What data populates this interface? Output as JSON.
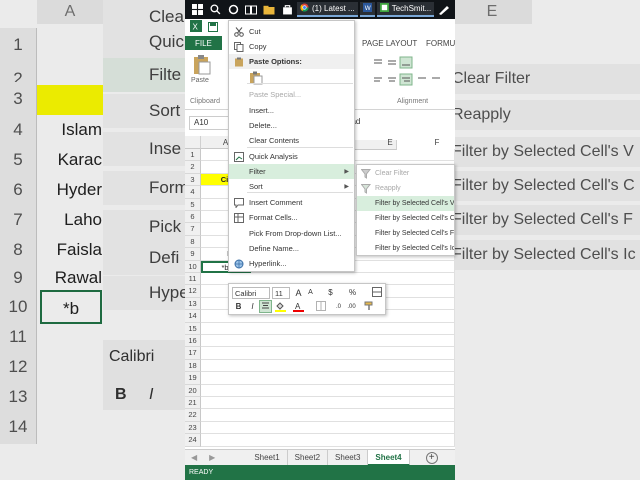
{
  "background": {
    "cities": [
      "Islam",
      "Karac",
      "Hyder",
      "Laho",
      "Faisla",
      "Rawal",
      "*b"
    ],
    "row_numbers": [
      "1",
      "2",
      "3",
      "4",
      "5",
      "6",
      "7",
      "8",
      "9",
      "10",
      "11",
      "12",
      "13",
      "14"
    ],
    "col_headers": [
      "A",
      "E"
    ],
    "menu_items": [
      "Clea",
      "Quic",
      "Filte",
      "Sort",
      "Inse",
      "Form",
      "Pick",
      "Defi",
      "Hype"
    ],
    "submenu_items": [
      "Clear Filter",
      "Reapply",
      "Filter by Selected Cell's V",
      "Filter by Selected Cell's C",
      "Filter by Selected Cell's F",
      "Filter by Selected Cell's Ic"
    ],
    "font_name": "Calibri",
    "bold": "B",
    "italic": "I"
  },
  "taskbar": {
    "apps": [
      {
        "icon": "chrome-icon",
        "label": "(1) Latest ..."
      },
      {
        "icon": "word-icon",
        "label": ""
      },
      {
        "icon": "techsmith-icon",
        "label": "TechSmit..."
      }
    ]
  },
  "ribbon": {
    "tabs": [
      "FILE",
      "PAGE LAYOUT",
      "FORMUL"
    ],
    "paste_label": "Paste",
    "clipboard_label": "Clipboard",
    "alignment_label": "Alignment"
  },
  "formula_bar": {
    "name_box": "A10",
    "content": "oad"
  },
  "grid": {
    "columns": [
      "",
      "A",
      "",
      "",
      "E",
      "F"
    ],
    "rows": [
      "1",
      "2",
      "3",
      "4",
      "5",
      "6",
      "7",
      "8",
      "9",
      "10",
      "11",
      "12",
      "13",
      "14",
      "15",
      "16",
      "17",
      "18",
      "19",
      "20",
      "21",
      "22",
      "23",
      "24"
    ],
    "cells": [
      {
        "row": 3,
        "text": "Ci",
        "style": "header"
      },
      {
        "row": 4,
        "text": "Islam"
      },
      {
        "row": 5,
        "text": "Kara"
      },
      {
        "row": 6,
        "text": "Hyder"
      },
      {
        "row": 7,
        "text": "Lah"
      },
      {
        "row": 8,
        "text": "Faisl"
      },
      {
        "row": 9,
        "text": "Rawal"
      },
      {
        "row": 10,
        "text": "*b",
        "style": "active"
      }
    ],
    "header_color": "#ffff00"
  },
  "context_menu": {
    "items": [
      {
        "label": "Cut",
        "icon": "scissors-icon",
        "state": "normal"
      },
      {
        "label": "Copy",
        "icon": "copy-icon",
        "state": "normal"
      },
      {
        "label": "Paste Options:",
        "icon": "clipboard-icon",
        "state": "section"
      },
      {
        "label": "",
        "icon": "paste-icon",
        "state": "paste-btn"
      },
      {
        "label": "Paste Special...",
        "icon": "",
        "state": "disabled"
      },
      {
        "label": "Insert...",
        "icon": "",
        "state": "normal"
      },
      {
        "label": "Delete...",
        "icon": "",
        "state": "normal"
      },
      {
        "label": "Clear Contents",
        "icon": "",
        "state": "normal"
      },
      {
        "label": "Quick Analysis",
        "icon": "quick-analysis-icon",
        "state": "normal"
      },
      {
        "label": "Filter",
        "icon": "",
        "state": "highlight",
        "submenu": true
      },
      {
        "label": "Sort",
        "icon": "",
        "state": "normal",
        "submenu": true
      },
      {
        "label": "Insert Comment",
        "icon": "comment-icon",
        "state": "normal"
      },
      {
        "label": "Format Cells...",
        "icon": "format-cells-icon",
        "state": "normal"
      },
      {
        "label": "Pick From Drop-down List...",
        "icon": "",
        "state": "normal"
      },
      {
        "label": "Define Name...",
        "icon": "",
        "state": "normal"
      },
      {
        "label": "Hyperlink...",
        "icon": "hyperlink-icon",
        "state": "normal"
      }
    ]
  },
  "filter_submenu": {
    "items": [
      {
        "label": "Clear Filter",
        "icon": "clear-filter-icon",
        "state": "disabled"
      },
      {
        "label": "Reapply",
        "icon": "reapply-icon",
        "state": "disabled"
      },
      {
        "label": "Filter by Selected Cell's V",
        "icon": "",
        "state": "highlight"
      },
      {
        "label": "Filter by Selected Cell's C",
        "icon": "",
        "state": "normal"
      },
      {
        "label": "Filter by Selected Cell's F",
        "icon": "",
        "state": "normal"
      },
      {
        "label": "Filter by Selected Cell's Ic",
        "icon": "",
        "state": "normal"
      }
    ]
  },
  "mini_toolbar": {
    "font": "Calibri",
    "size": "11",
    "grow": "A",
    "shrink": "A",
    "currency": "$",
    "percent": "%",
    "bold": "B",
    "italic": "I"
  },
  "sheets": {
    "tabs": [
      "Sheet1",
      "Sheet2",
      "Sheet3",
      "Sheet4"
    ],
    "active": "Sheet4"
  },
  "status": {
    "text": "READY"
  },
  "colors": {
    "excel_green": "#217346",
    "highlight": "#d8eedd"
  }
}
